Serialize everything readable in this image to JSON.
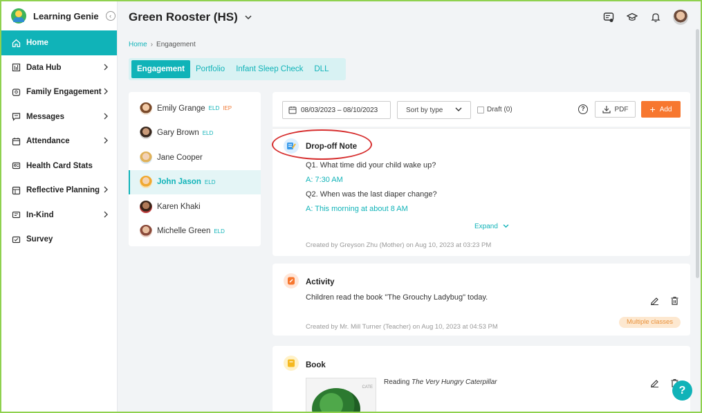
{
  "brand": {
    "name": "Learning Genie"
  },
  "sidebar": {
    "items": [
      {
        "label": "Home",
        "icon": "home-icon",
        "active": true,
        "chevron": false,
        "dot": false
      },
      {
        "label": "Data Hub",
        "icon": "chart-icon",
        "active": false,
        "chevron": true,
        "dot": false
      },
      {
        "label": "Family Engagement",
        "icon": "family-icon",
        "active": false,
        "chevron": true,
        "dot": false
      },
      {
        "label": "Messages",
        "icon": "message-icon",
        "active": false,
        "chevron": true,
        "dot": false
      },
      {
        "label": "Attendance",
        "icon": "calendar-icon",
        "active": false,
        "chevron": true,
        "dot": false
      },
      {
        "label": "Health Card Stats",
        "icon": "health-card-icon",
        "active": false,
        "chevron": false,
        "dot": false
      },
      {
        "label": "Reflective Planning",
        "icon": "planning-icon",
        "active": false,
        "chevron": true,
        "dot": false
      },
      {
        "label": "In-Kind",
        "icon": "inkind-icon",
        "active": false,
        "chevron": true,
        "dot": true
      },
      {
        "label": "Survey",
        "icon": "survey-icon",
        "active": false,
        "chevron": false,
        "dot": true
      }
    ]
  },
  "header": {
    "class_name": "Green Rooster (HS)"
  },
  "breadcrumb": {
    "home": "Home",
    "current": "Engagement"
  },
  "tabs": [
    "Engagement",
    "Portfolio",
    "Infant Sleep Check",
    "DLL"
  ],
  "children": [
    {
      "name": "Emily Grange",
      "eld": "ELD",
      "iep": "IEP",
      "active": false
    },
    {
      "name": "Gary Brown",
      "eld": "ELD",
      "iep": "",
      "active": false
    },
    {
      "name": "Jane Cooper",
      "eld": "",
      "iep": "",
      "active": false
    },
    {
      "name": "John Jason",
      "eld": "ELD",
      "iep": "",
      "active": true
    },
    {
      "name": "Karen Khaki",
      "eld": "",
      "iep": "",
      "active": false
    },
    {
      "name": "Michelle Green",
      "eld": "ELD",
      "iep": "",
      "active": false
    }
  ],
  "toolbar": {
    "date_range": "08/03/2023 – 08/10/2023",
    "sort": "Sort by type",
    "draft": "Draft (0)",
    "pdf": "PDF",
    "add": "Add"
  },
  "cards": {
    "dropoff": {
      "title": "Drop-off Note",
      "q1": "Q1. What time did your child wake up?",
      "a1": "A: 7:30 AM",
      "q2": "Q2. When was the last diaper change?",
      "a2": "A: This morning at about 8 AM",
      "expand": "Expand",
      "created": "Created by Greyson Zhu (Mother) on Aug 10, 2023 at 03:23 PM"
    },
    "activity": {
      "title": "Activity",
      "text": "Children read the book \"The Grouchy Ladybug\" today.",
      "created": "Created by Mr. Mill Turner (Teacher) on Aug 10, 2023 at 04:53 PM",
      "badge": "Multiple classes"
    },
    "book": {
      "title": "Book",
      "reading_prefix": "Reading",
      "book_title": "The Very Hungry Caterpillar",
      "cover_text": "CATE"
    }
  },
  "colors": {
    "accent": "#10b3b8",
    "orange": "#f7772f",
    "annotation": "#d62d2d"
  },
  "help": "?"
}
